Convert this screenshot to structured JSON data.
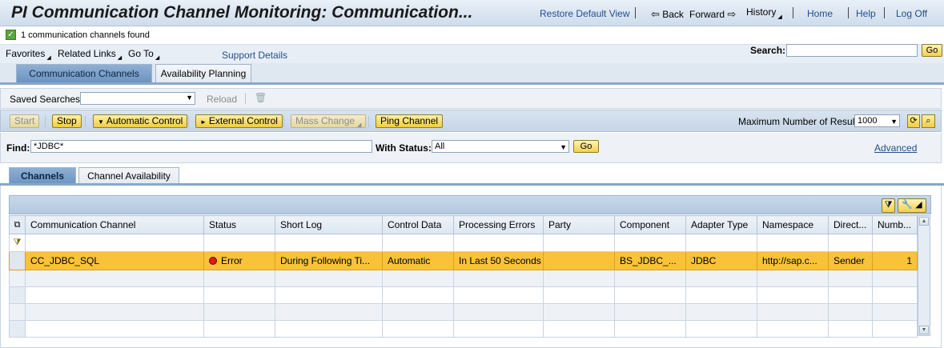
{
  "header": {
    "title": "PI Communication Channel Monitoring: Communication...",
    "links": {
      "restore": "Restore Default View",
      "back": "Back",
      "forward": "Forward",
      "history": "History",
      "home": "Home",
      "help": "Help",
      "logoff": "Log Off"
    }
  },
  "status": {
    "message": "1 communication channels found"
  },
  "menubar": {
    "favorites": "Favorites",
    "related_links": "Related Links",
    "go_to": "Go To",
    "support_details": "Support Details",
    "search_label": "Search:",
    "search_value": "",
    "search_go": "Go"
  },
  "top_tabs": [
    "Communication Channels",
    "Availability Planning"
  ],
  "saved_searches": {
    "label": "Saved Searches:",
    "value": "",
    "reload": "Reload"
  },
  "actions": {
    "start": "Start",
    "stop": "Stop",
    "automatic_control": "Automatic Control",
    "external_control": "External Control",
    "mass_change": "Mass Change",
    "ping_channel": "Ping Channel",
    "max_results_label": "Maximum Number of Result:",
    "max_results_value": "1000"
  },
  "find": {
    "label": "Find:",
    "value": "*JDBC*",
    "status_label": "With Status:",
    "status_value": "All",
    "go": "Go",
    "advanced": "Advanced"
  },
  "lower_tabs": [
    "Channels",
    "Channel Availability"
  ],
  "table": {
    "columns": [
      "Communication Channel",
      "Status",
      "Short Log",
      "Control Data",
      "Processing Errors",
      "Party",
      "Component",
      "Adapter Type",
      "Namespace",
      "Direct...",
      "Numb..."
    ],
    "rows": [
      [
        "CC_JDBC_SQL",
        "Error",
        "During Following Ti...",
        "Automatic",
        "In Last 50 Seconds",
        "",
        "BS_JDBC_...",
        "JDBC",
        "http://sap.c...",
        "Sender",
        "1"
      ]
    ]
  },
  "colors": {
    "accent": "#1f4f8f",
    "selected_row": "#f8c23a",
    "error": "#e01818"
  }
}
